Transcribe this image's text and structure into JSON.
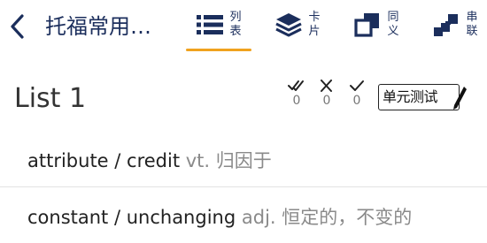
{
  "header": {
    "title": "托福常用…",
    "tabs": [
      {
        "label": "列表",
        "icon": "list-icon",
        "active": true
      },
      {
        "label": "卡片",
        "icon": "cards-stack-icon",
        "active": false
      },
      {
        "label": "同义",
        "icon": "synonym-squares-icon",
        "active": false
      },
      {
        "label": "串联",
        "icon": "chain-steps-icon",
        "active": false
      }
    ]
  },
  "list": {
    "title": "List 1",
    "stats": [
      {
        "icon": "double-check-icon",
        "count": "0"
      },
      {
        "icon": "cross-icon",
        "count": "0"
      },
      {
        "icon": "check-icon",
        "count": "0"
      }
    ],
    "unit_test_label": "单元测试"
  },
  "words": [
    {
      "word": "attribute / credit",
      "pos": "vt.",
      "meaning": "归因于"
    },
    {
      "word": "constant / unchanging",
      "pos": "adj.",
      "meaning": "恒定的，不变的"
    }
  ],
  "colors": {
    "accent": "#f0a21e",
    "brand": "#1b2e5c"
  }
}
